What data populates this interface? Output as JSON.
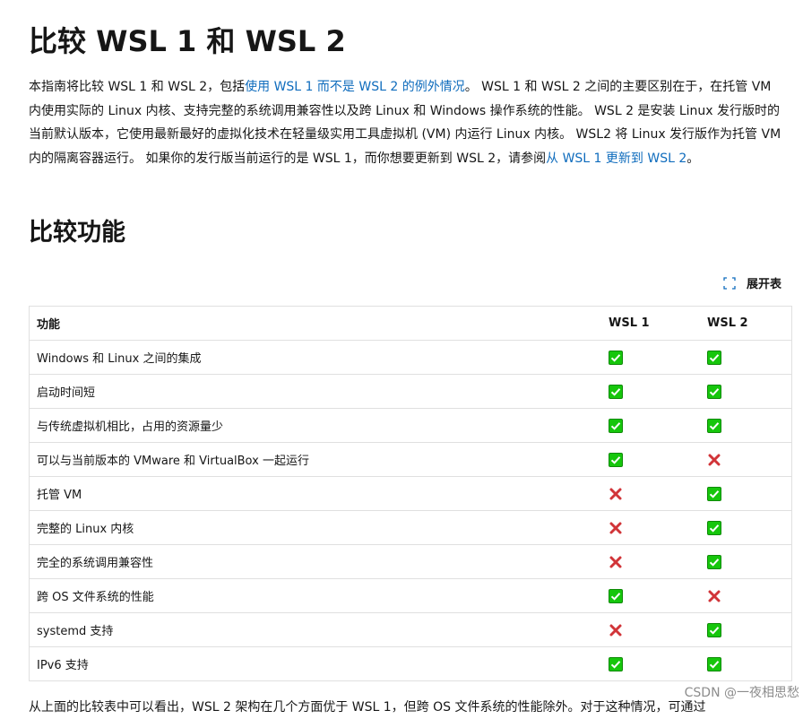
{
  "title": "比较 WSL 1 和 WSL 2",
  "intro": {
    "part1": "本指南将比较 WSL 1 和 WSL 2，包括",
    "link1": "使用 WSL 1 而不是 WSL 2 的例外情况",
    "part2": "。 WSL 1 和 WSL 2 之间的主要区别在于，在托管 VM 内使用实际的 Linux 内核、支持完整的系统调用兼容性以及跨 Linux 和 Windows 操作系统的性能。 WSL 2 是安装 Linux 发行版时的当前默认版本，它使用最新最好的虚拟化技术在轻量级实用工具虚拟机 (VM) 内运行 Linux 内核。 WSL2 将 Linux 发行版作为托管 VM 内的隔离容器运行。 如果你的发行版当前运行的是 WSL 1，而你想要更新到 WSL 2，请参阅",
    "link2": "从 WSL 1 更新到 WSL 2",
    "part3": "。"
  },
  "section_title": "比较功能",
  "expand_label": "展开表",
  "table": {
    "headers": [
      "功能",
      "WSL 1",
      "WSL 2"
    ],
    "rows": [
      {
        "feature": "Windows 和 Linux 之间的集成",
        "wsl1": "yes",
        "wsl2": "yes"
      },
      {
        "feature": "启动时间短",
        "wsl1": "yes",
        "wsl2": "yes"
      },
      {
        "feature": "与传统虚拟机相比，占用的资源量少",
        "wsl1": "yes",
        "wsl2": "yes"
      },
      {
        "feature": "可以与当前版本的 VMware 和 VirtualBox 一起运行",
        "wsl1": "yes",
        "wsl2": "no"
      },
      {
        "feature": "托管 VM",
        "wsl1": "no",
        "wsl2": "yes"
      },
      {
        "feature": "完整的 Linux 内核",
        "wsl1": "no",
        "wsl2": "yes"
      },
      {
        "feature": "完全的系统调用兼容性",
        "wsl1": "no",
        "wsl2": "yes"
      },
      {
        "feature": "跨 OS 文件系统的性能",
        "wsl1": "yes",
        "wsl2": "no"
      },
      {
        "feature": "systemd 支持",
        "wsl1": "no",
        "wsl2": "yes"
      },
      {
        "feature": "IPv6 支持",
        "wsl1": "yes",
        "wsl2": "yes"
      }
    ]
  },
  "bottom_text": "从上面的比较表中可以看出，WSL 2 架构在几个方面优于 WSL 1，但跨 OS 文件系统的性能除外。对于这种情况，可通过",
  "watermark": "CSDN @一夜相思愁",
  "colors": {
    "link": "#0f6cbd",
    "check_bg": "#16c60c",
    "cross": "#d13438"
  },
  "icons": {
    "yes": "green-check-icon",
    "no": "red-cross-icon",
    "expand": "fullscreen-expand-icon"
  }
}
